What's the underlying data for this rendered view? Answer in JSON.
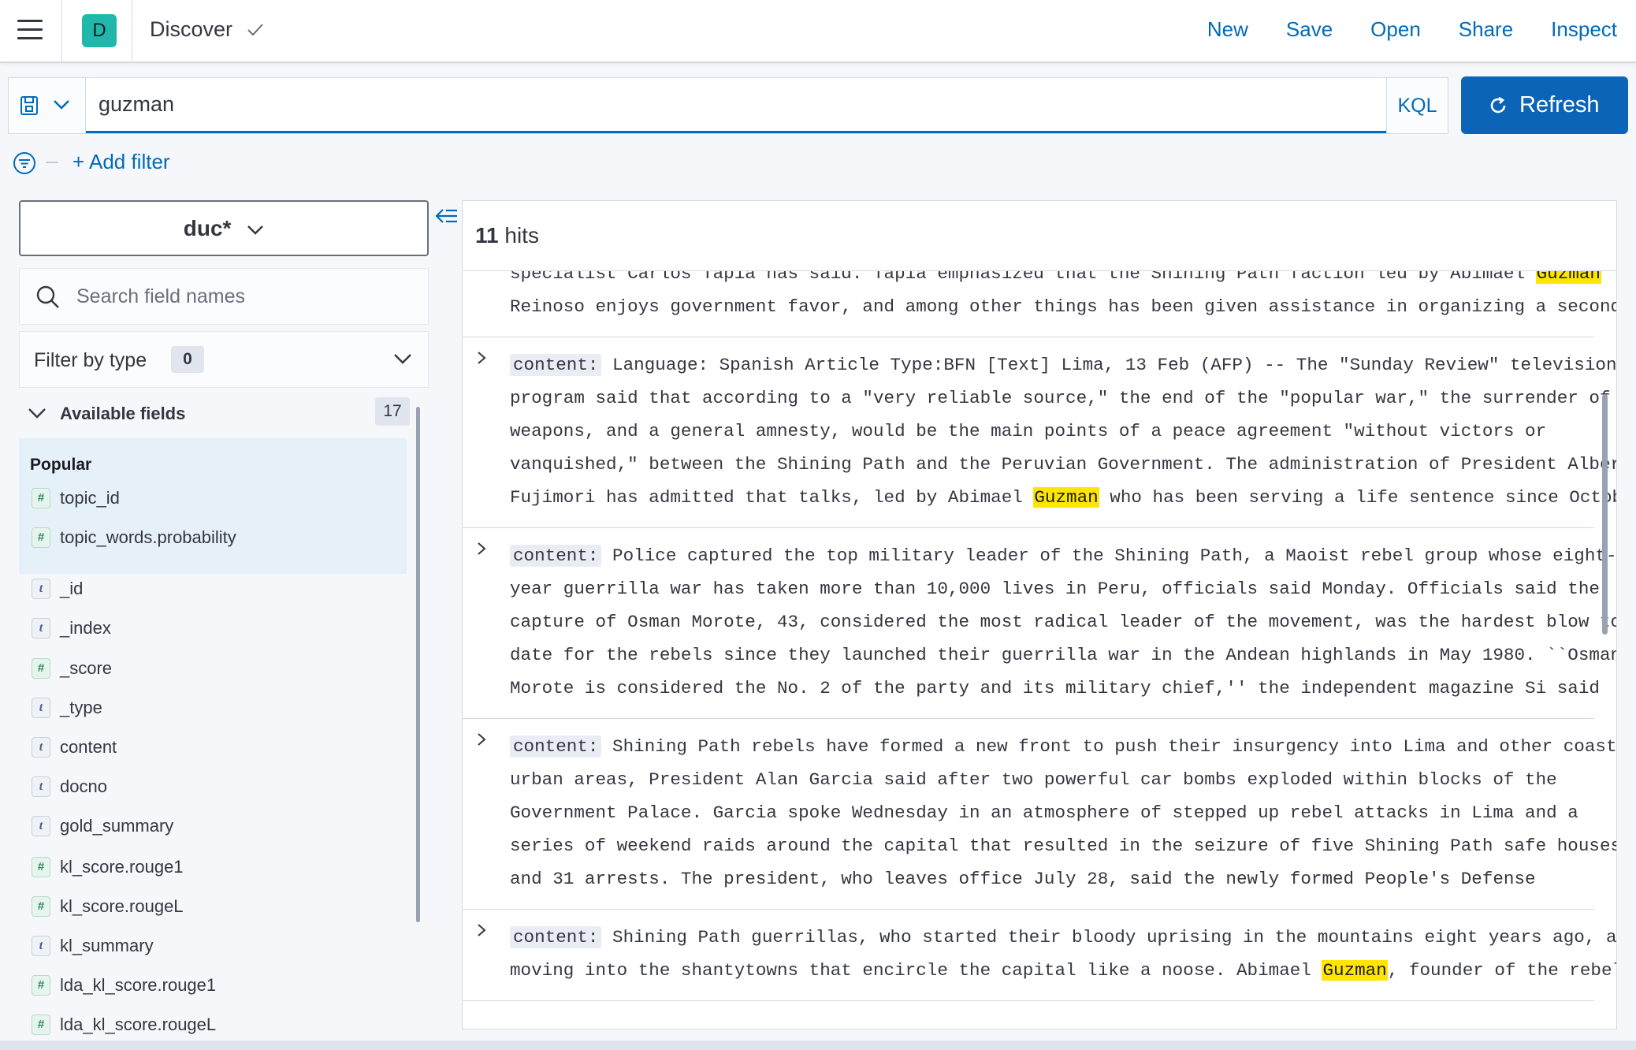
{
  "header": {
    "space_initial": "D",
    "breadcrumb": "Discover",
    "nav": [
      "New",
      "Save",
      "Open",
      "Share",
      "Inspect"
    ]
  },
  "query": {
    "value": "guzman",
    "language": "KQL",
    "refresh_label": "Refresh"
  },
  "filter_bar": {
    "add_filter": "+ Add filter"
  },
  "sidebar": {
    "index_pattern": "duc*",
    "search_placeholder": "Search field names",
    "filter_by_type": "Filter by type",
    "filter_count": "0",
    "available_label": "Available fields",
    "available_count": "17",
    "popular_title": "Popular",
    "popular_fields": [
      {
        "name": "topic_id",
        "type": "#"
      },
      {
        "name": "topic_words.probability",
        "type": "#"
      }
    ],
    "fields": [
      {
        "name": "_id",
        "type": "t"
      },
      {
        "name": "_index",
        "type": "t"
      },
      {
        "name": "_score",
        "type": "#"
      },
      {
        "name": "_type",
        "type": "t"
      },
      {
        "name": "content",
        "type": "t"
      },
      {
        "name": "docno",
        "type": "t"
      },
      {
        "name": "gold_summary",
        "type": "t"
      },
      {
        "name": "kl_score.rouge1",
        "type": "#"
      },
      {
        "name": "kl_score.rougeL",
        "type": "#"
      },
      {
        "name": "kl_summary",
        "type": "t"
      },
      {
        "name": "lda_kl_score.rouge1",
        "type": "#"
      },
      {
        "name": "lda_kl_score.rougeL",
        "type": "#"
      }
    ]
  },
  "results": {
    "hits_count": "11",
    "hits_label": "hits",
    "highlight": "Guzman",
    "field_label": "content:",
    "rows": [
      {
        "lines": [
          "specialist Carlos Tapia has said. Tapia emphasized that the Shining Path faction led by Abimael ",
          "Reinoso enjoys government favor, and among other things has been given assistance in organizing a second"
        ],
        "partial": true
      },
      {
        "lines": [
          "Language: Spanish Article Type:BFN [Text] Lima, 13 Feb (AFP) -- The \"Sunday Review\" television",
          "program said that according to a \"very reliable source,\" the end of the \"popular war,\" the surrender of",
          "weapons, and a general amnesty, would be the main points of a peace agreement \"without victors or",
          "vanquished,\" between the Shining Path and the Peruvian Government. The administration of President Alberto",
          "Fujimori has admitted that talks, led by Abimael |Guzman| who has been serving a life sentence since October"
        ]
      },
      {
        "lines": [
          "Police captured the top military leader of the Shining Path, a Maoist rebel group whose eight-",
          "year guerrilla war has taken more than 10,000 lives in Peru, officials said Monday. Officials said the",
          "capture of Osman Morote, 43, considered the most radical leader of the movement, was the hardest blow to",
          "date for the rebels since they launched their guerrilla war in the Andean highlands in May 1980. ``Osman",
          "Morote is considered the No. 2 of the party and its military chief,'' the independent magazine Si said"
        ]
      },
      {
        "lines": [
          "Shining Path rebels have formed a new front to push their insurgency into Lima and other coastal",
          "urban areas, President Alan Garcia said after two powerful car bombs exploded within blocks of the",
          "Government Palace. Garcia spoke Wednesday in an atmosphere of stepped up rebel attacks in Lima and a",
          "series of weekend raids around the capital that resulted in the seizure of five Shining Path safe houses",
          "and 31 arrests. The president, who leaves office July 28, said the newly formed People's Defense"
        ]
      },
      {
        "lines": [
          "Shining Path guerrillas, who started their bloody uprising in the mountains eight years ago, are",
          "moving into the shantytowns that encircle the capital like a noose. Abimael |Guzman|, founder of the rebel"
        ]
      }
    ]
  },
  "colors": {
    "accent": "#006bb8",
    "refresh_bg": "#0b64b8",
    "space_avatar": "#1fb8ab",
    "highlight": "#ffe500"
  },
  "icons": [
    "menu-icon",
    "check-icon",
    "save-disk-icon",
    "chevron-down-icon",
    "refresh-icon",
    "filter-icon",
    "collapse-icon",
    "search-icon",
    "chevron-right-icon"
  ]
}
